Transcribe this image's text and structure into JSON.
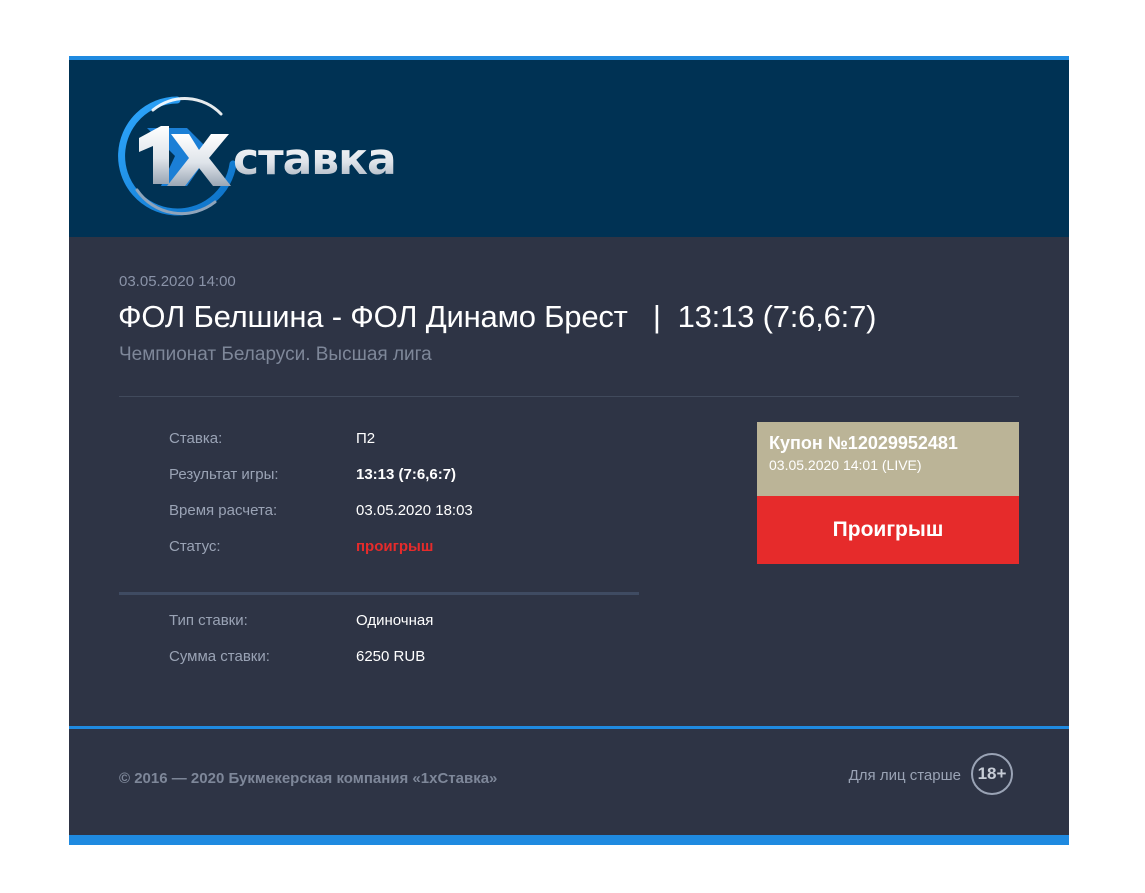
{
  "brand": {
    "logo_text": "1xСтавка"
  },
  "event": {
    "datetime": "03.05.2020 14:00",
    "title": "ФОЛ Белшина - ФОЛ Динамо Брест   |  13:13 (7:6,6:7)",
    "league": "Чемпионат Беларуси. Высшая лига"
  },
  "details": [
    {
      "label": "Ставка:",
      "value": "П2",
      "style": "normal"
    },
    {
      "label": "Результат игры:",
      "value": "13:13 (7:6,6:7)",
      "style": "bold"
    },
    {
      "label": "Время расчета:",
      "value": "03.05.2020 18:03",
      "style": "normal"
    },
    {
      "label": "Статус:",
      "value": "проигрыш",
      "style": "lost"
    }
  ],
  "bet_info": [
    {
      "label": "Тип ставки:",
      "value": "Одиночная"
    },
    {
      "label": "Сумма ставки:",
      "value": "6250 RUB"
    }
  ],
  "coupon": {
    "number": "Купон №12029952481",
    "date": "03.05.2020 14:01 (LIVE)",
    "result": "Проигрыш"
  },
  "footer": {
    "copyright": "© 2016 — 2020 Букмекерская компания «1xСтавка»",
    "age_text": "Для лиц старше",
    "age_badge": "18+"
  },
  "colors": {
    "header_bg": "#003254",
    "body_bg": "#2e3445",
    "accent_blue": "#1f8ae0",
    "coupon_head": "#bbb497",
    "lost_red": "#e62b2b"
  },
  "icons": {
    "logo": "1xstavka-logo-icon"
  }
}
